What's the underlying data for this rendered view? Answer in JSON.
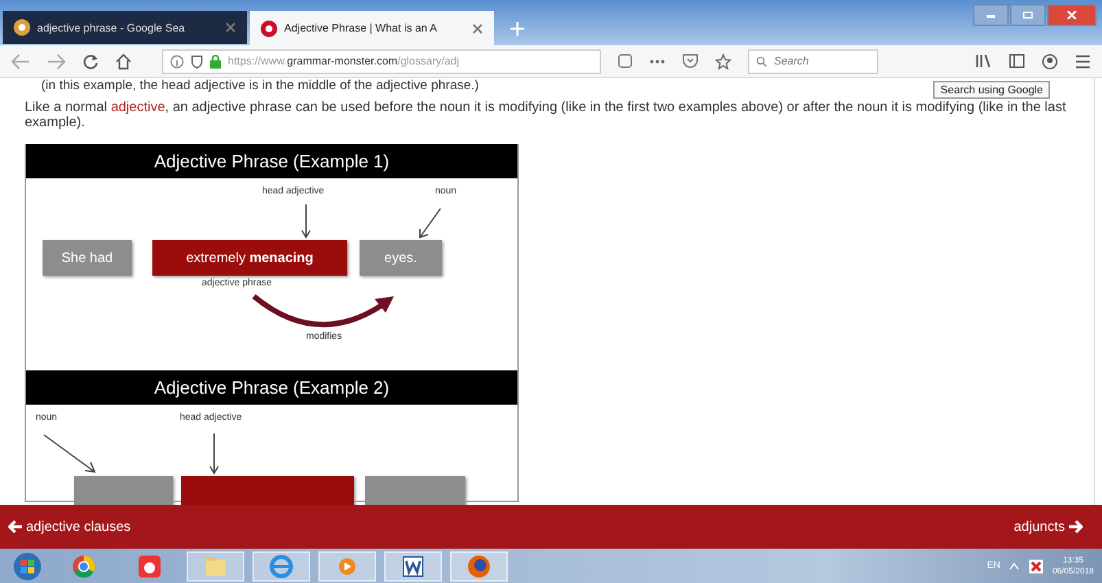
{
  "tabs": [
    {
      "label": "adjective phrase - Google Sea",
      "selected": false
    },
    {
      "label": "Adjective Phrase | What is an A",
      "selected": true
    }
  ],
  "address_bar": {
    "url_prefix": "https://www.",
    "url_domain": "grammar-monster.com",
    "url_path": "/glossary/adj"
  },
  "search": {
    "placeholder": "Search",
    "tooltip": "Search using Google"
  },
  "content": {
    "cut_line": "(in this example, the head adjective is in the middle of the adjective phrase.)",
    "paragraph_before": "Like a normal ",
    "paragraph_link": "adjective",
    "paragraph_after": ", an adjective phrase can be used before the noun it is modifying (like in the first two examples above) or after the noun it is modifying (like in the last example).",
    "examples": [
      {
        "title": "Adjective Phrase (Example 1)",
        "head_label": "head adjective",
        "noun_label": "noun",
        "words": [
          "She had",
          "extremely **menacing**",
          "eyes."
        ],
        "phrase_label": "adjective phrase",
        "modifies_label": "modifies"
      },
      {
        "title": "Adjective Phrase (Example 2)",
        "head_label": "head adjective",
        "noun_label": "noun"
      }
    ]
  },
  "footer_nav": {
    "previous": "adjective clauses",
    "next": "adjuncts"
  },
  "taskbar": {
    "language": "EN",
    "time": "13:35",
    "date": "06/05/2018"
  }
}
